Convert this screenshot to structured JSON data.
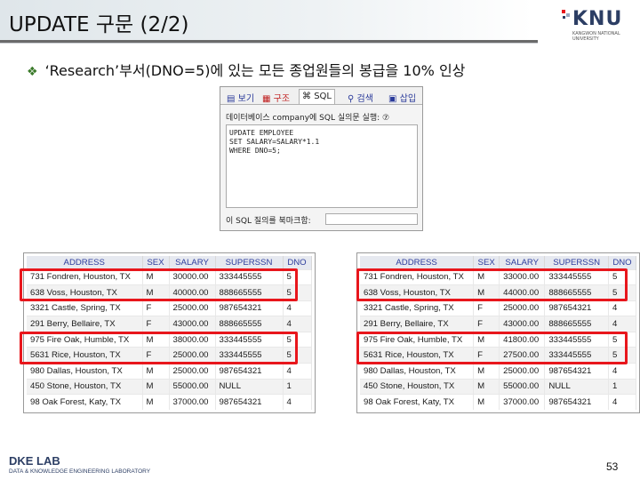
{
  "slide": {
    "title": "UPDATE 구문 (2/2)",
    "bullet": "‘Research’부서(DNO=5)에 있는 모든 종업원들의 봉급을 10% 인상",
    "page_number": "53"
  },
  "logo": {
    "name": "KNU",
    "sub": "KANGWON NATIONAL UNIVERSITY"
  },
  "footer": {
    "lab": "DKE LAB",
    "lab_sub": "DATA & KNOWLEDGE ENGINEERING LABORATORY"
  },
  "sql_panel": {
    "tabs": [
      "보기",
      "구조",
      "SQL",
      "검색",
      "삽입"
    ],
    "database_line": "데이터베이스 company에 SQL 실의문 실행: ⑦",
    "query_lines": [
      "UPDATE EMPLOYEE",
      "SET SALARY=SALARY*1.1",
      "WHERE DNO=5;"
    ],
    "bottom_label": "이 SQL 질의를 북마크함:"
  },
  "table_columns": [
    "ADDRESS",
    "SEX",
    "SALARY",
    "SUPERSSN",
    "DNO"
  ],
  "before_rows": [
    [
      "731 Fondren, Houston, TX",
      "M",
      "30000.00",
      "333445555",
      "5"
    ],
    [
      "638 Voss, Houston, TX",
      "M",
      "40000.00",
      "888665555",
      "5"
    ],
    [
      "3321 Castle, Spring, TX",
      "F",
      "25000.00",
      "987654321",
      "4"
    ],
    [
      "291 Berry, Bellaire, TX",
      "F",
      "43000.00",
      "888665555",
      "4"
    ],
    [
      "975 Fire Oak, Humble, TX",
      "M",
      "38000.00",
      "333445555",
      "5"
    ],
    [
      "5631 Rice, Houston, TX",
      "F",
      "25000.00",
      "333445555",
      "5"
    ],
    [
      "980 Dallas, Houston, TX",
      "M",
      "25000.00",
      "987654321",
      "4"
    ],
    [
      "450 Stone, Houston, TX",
      "M",
      "55000.00",
      "NULL",
      "1"
    ],
    [
      "98 Oak Forest, Katy, TX",
      "M",
      "37000.00",
      "987654321",
      "4"
    ]
  ],
  "after_rows": [
    [
      "731 Fondren, Houston, TX",
      "M",
      "33000.00",
      "333445555",
      "5"
    ],
    [
      "638 Voss, Houston, TX",
      "M",
      "44000.00",
      "888665555",
      "5"
    ],
    [
      "3321 Castle, Spring, TX",
      "F",
      "25000.00",
      "987654321",
      "4"
    ],
    [
      "291 Berry, Bellaire, TX",
      "F",
      "43000.00",
      "888665555",
      "4"
    ],
    [
      "975 Fire Oak, Humble, TX",
      "M",
      "41800.00",
      "333445555",
      "5"
    ],
    [
      "5631 Rice, Houston, TX",
      "F",
      "27500.00",
      "333445555",
      "5"
    ],
    [
      "980 Dallas, Houston, TX",
      "M",
      "25000.00",
      "987654321",
      "4"
    ],
    [
      "450 Stone, Houston, TX",
      "M",
      "55000.00",
      "NULL",
      "1"
    ],
    [
      "98 Oak Forest, Katy, TX",
      "M",
      "37000.00",
      "987654321",
      "4"
    ]
  ],
  "colors": {
    "highlight": "#e8161c",
    "header_text": "#2c3c9c",
    "brand": "#2c3e64"
  }
}
